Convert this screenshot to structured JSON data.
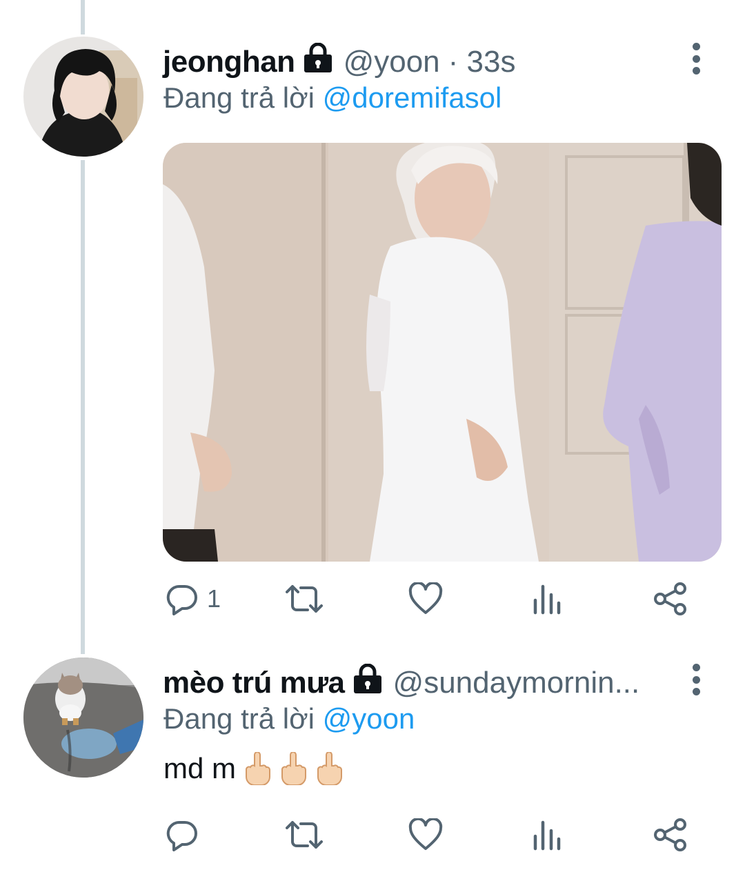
{
  "tweets": [
    {
      "name": "jeonghan",
      "handle": "@yoon",
      "time": "· 33s",
      "reply_prefix": "Đang trả lời",
      "reply_to": "@doremifasol",
      "reply_count": "1",
      "has_media": true
    },
    {
      "name": "mèo trú mưa",
      "handle": "@sundaymornin...",
      "reply_prefix": "Đang trả lời",
      "reply_to": "@yoon",
      "text": "md m",
      "emoji": [
        "middle-finger-emoji",
        "middle-finger-emoji",
        "middle-finger-emoji"
      ],
      "reply_count": ""
    }
  ],
  "colors": {
    "accent": "#1d9bf0",
    "secondary_text": "#536471",
    "thread_line": "#cfd9de"
  },
  "icons": [
    "lock-icon",
    "more-icon",
    "reply-icon",
    "retweet-icon",
    "like-icon",
    "views-icon",
    "share-icon"
  ]
}
